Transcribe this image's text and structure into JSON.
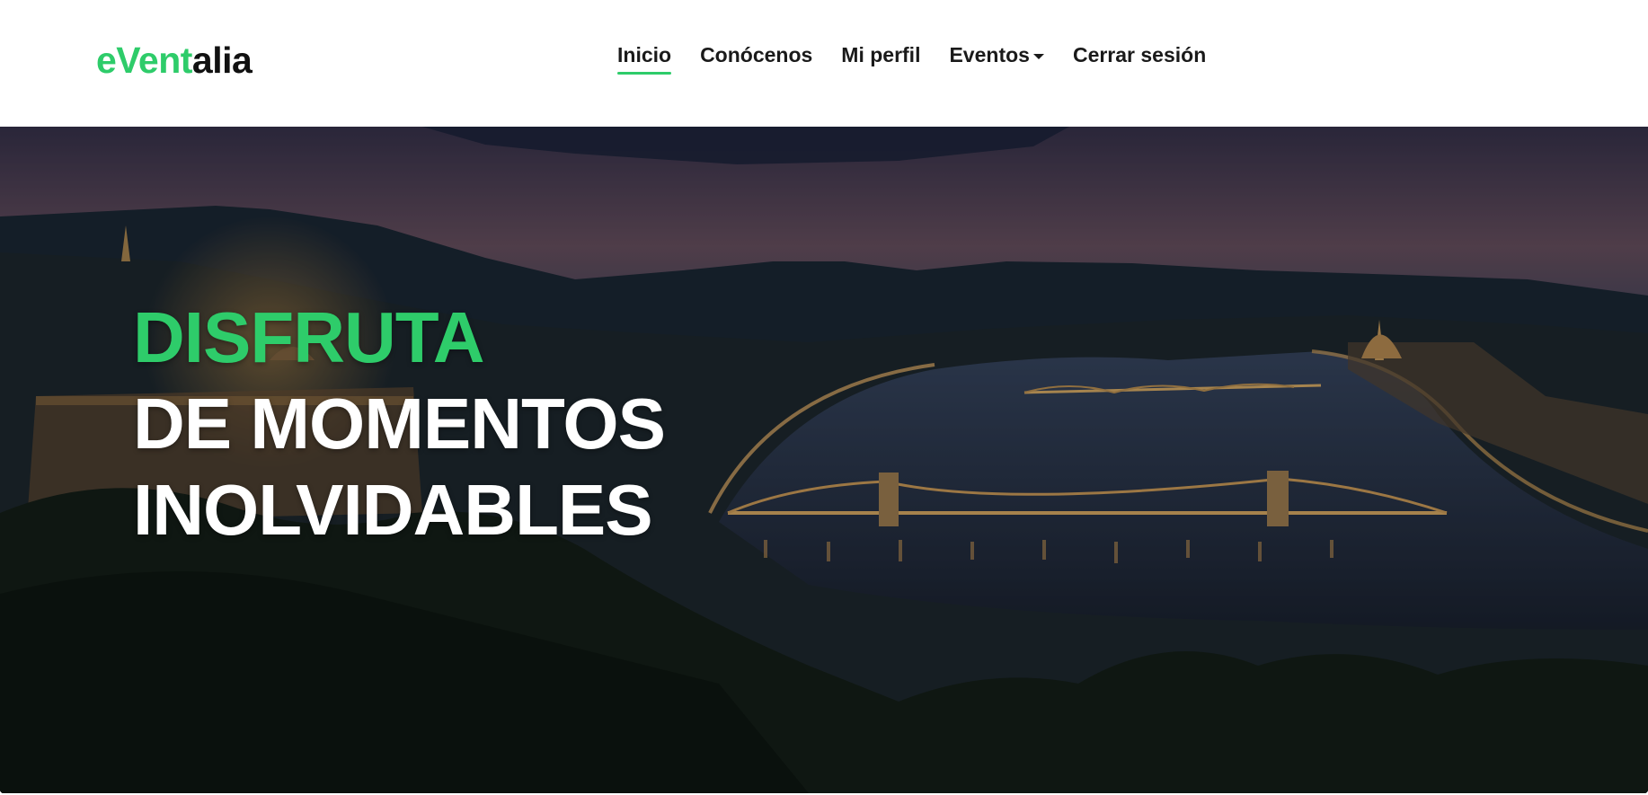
{
  "brand": {
    "accent_part": "eVent",
    "rest_part": "alia"
  },
  "nav": {
    "items": [
      {
        "label": "Inicio",
        "active": true
      },
      {
        "label": "Conócenos"
      },
      {
        "label": "Mi perfil"
      },
      {
        "label": "Eventos",
        "dropdown": true
      },
      {
        "label": "Cerrar sesión"
      }
    ]
  },
  "hero": {
    "line1": "DISFRUTA",
    "line2": "DE MOMENTOS",
    "line3": "INOLVIDABLES"
  },
  "colors": {
    "accent": "#2ecc6a",
    "text_dark": "#1a1a1a"
  }
}
